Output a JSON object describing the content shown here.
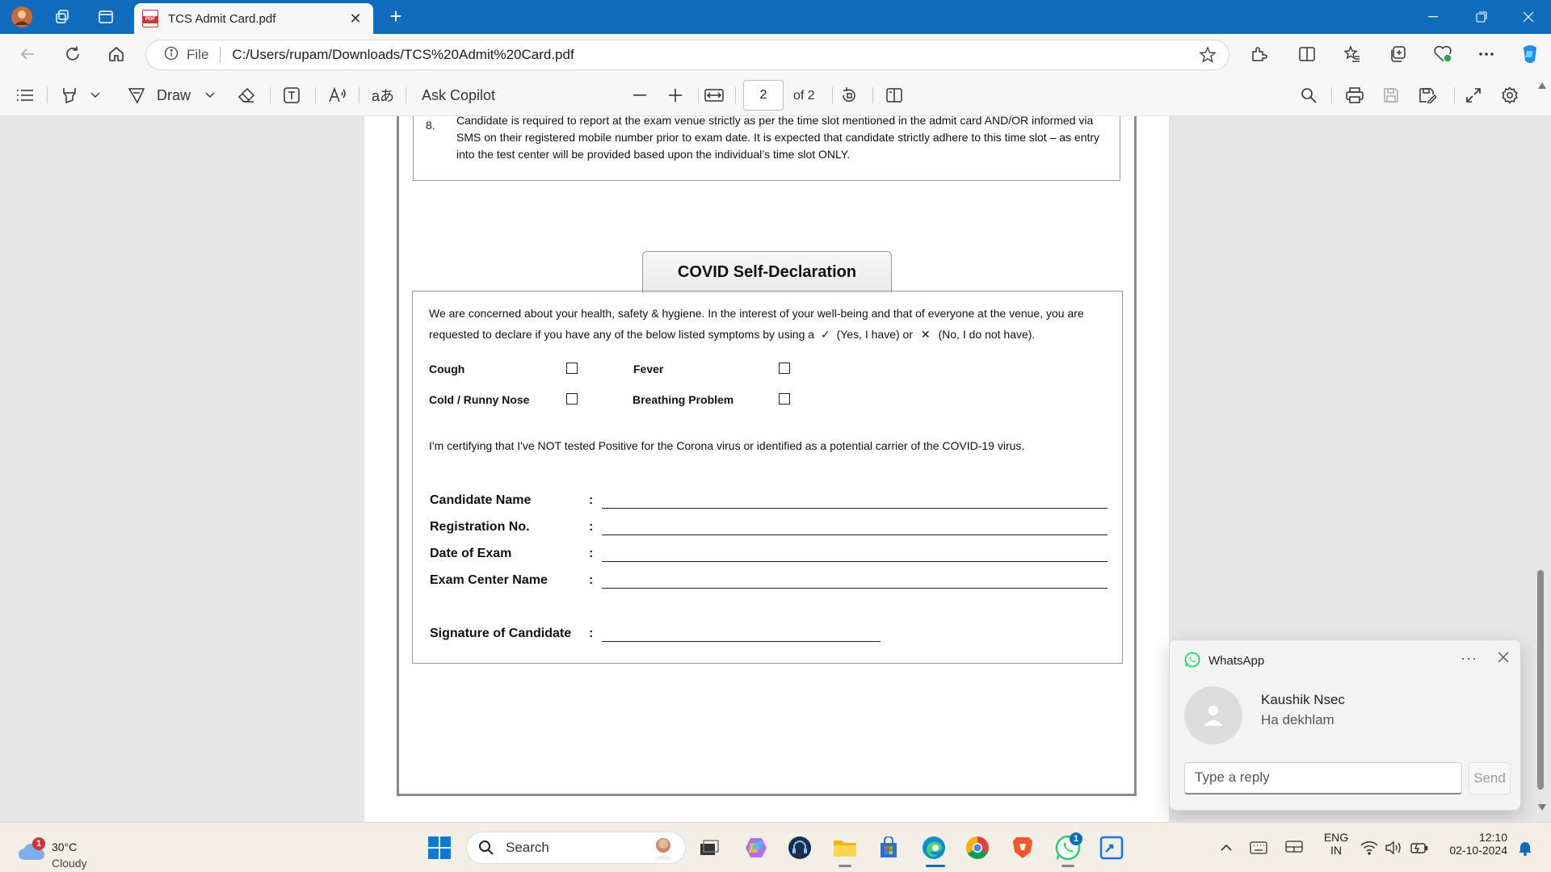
{
  "browser": {
    "tab_title": "TCS Admit Card.pdf",
    "new_tab_symbol": "+",
    "address": {
      "scheme_label": "File",
      "url": "C:/Users/rupam/Downloads/TCS%20Admit%20Card.pdf"
    }
  },
  "pdf_toolbar": {
    "draw_label": "Draw",
    "ask_copilot_label": "Ask Copilot",
    "page_current": "2",
    "page_total_label": "of 2"
  },
  "document": {
    "rule_number": "8.",
    "rule_text": "Candidate is required to report at the exam venue strictly as per the time slot mentioned in the admit card AND/OR informed via SMS on their registered mobile number prior to exam date. It is expected that candidate strictly adhere to this time slot – as entry into the test center will be provided based upon the individual’s time slot ONLY.",
    "covid_heading": "COVID Self-Declaration",
    "intro_line1": "We are concerned about your health, safety & hygiene. In the interest of your well-being and that of everyone at the venue, you are",
    "intro_line2_a": "requested to declare if you have any of the below listed symptoms by using a",
    "check_symbol": "✓",
    "intro_line2_b": "(Yes, I have) or",
    "cross_symbol": "✕",
    "intro_line2_c": "(No, I do not have).",
    "symptoms": {
      "cough": "Cough",
      "fever": "Fever",
      "cold": "Cold / Runny Nose",
      "breathing": "Breathing Problem"
    },
    "certification": "I'm certifying that I've NOT tested Positive for the Corona virus or identified as a potential carrier of the COVID-19 virus.",
    "fields": {
      "candidate_name": "Candidate Name",
      "registration_no": "Registration No.",
      "date_of_exam": "Date of Exam",
      "exam_center_name": "Exam Center Name",
      "signature": "Signature of Candidate",
      "colon": ":"
    }
  },
  "notification": {
    "app": "WhatsApp",
    "more": "···",
    "sender": "Kaushik Nsec",
    "message": "Ha dekhlam",
    "reply_placeholder": "Type a reply",
    "send_label": "Send"
  },
  "taskbar": {
    "weather_temp": "30°C",
    "weather_desc": "Cloudy",
    "weather_badge": "1",
    "search_label": "Search",
    "whatsapp_badge": "1",
    "lang_top": "ENG",
    "lang_bottom": "IN",
    "time": "12:10",
    "date": "02-10-2024"
  },
  "colors": {
    "titlebar": "#0f6cbd",
    "whatsapp_green": "#25d366",
    "badge_red": "#d13438"
  }
}
